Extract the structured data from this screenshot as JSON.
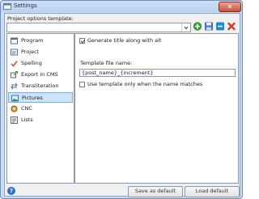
{
  "window": {
    "title": "Settings",
    "close_glyph": "✕"
  },
  "template": {
    "label": "Project options template:",
    "value": "",
    "buttons": [
      {
        "name": "add-template-icon",
        "color": "#2e9c3a"
      },
      {
        "name": "save-template-icon",
        "color": "#3a6fc4"
      },
      {
        "name": "rename-template-icon",
        "color": "#1c8ad0"
      },
      {
        "name": "delete-template-icon",
        "color": "#d23a2a"
      }
    ]
  },
  "sidebar": {
    "items": [
      {
        "label": "Program",
        "icon": "program-icon"
      },
      {
        "label": "Project",
        "icon": "project-icon"
      },
      {
        "label": "Spelling",
        "icon": "spelling-icon"
      },
      {
        "label": "Export in CMS",
        "icon": "export-icon"
      },
      {
        "label": "Transliteration",
        "icon": "transliteration-icon"
      },
      {
        "label": "Pictures",
        "icon": "pictures-icon",
        "active": true
      },
      {
        "label": "CNC",
        "icon": "cnc-icon"
      },
      {
        "label": "Lists",
        "icon": "lists-icon"
      }
    ]
  },
  "pictures": {
    "generate_title_label": "Generate title along with alt",
    "generate_title_checked": true,
    "template_file_label": "Template file name:",
    "template_file_value": "{post_name}_{increment}",
    "use_template_label": "Use template only when the name matches",
    "use_template_checked": false
  },
  "footer": {
    "help_glyph": "?",
    "save_default_label": "Save as default",
    "load_default_label": "Load default"
  },
  "colors": {
    "accent": "#84acd8",
    "selection": "#cde3f8"
  }
}
